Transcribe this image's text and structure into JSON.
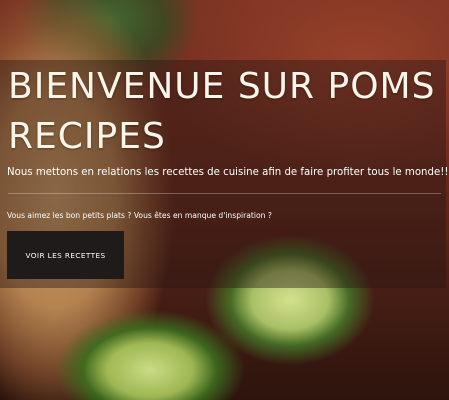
{
  "hero": {
    "title": "BIENVENUE SUR POMS RECIPES",
    "subtitle": "Nous mettons en relations les recettes de cuisine afin de faire profiter tous le monde!!",
    "question": "Vous aimez les bon petits plats ? Vous êtes en manque d'inspiration ?",
    "cta_label": "VOIR LES RECETTES"
  }
}
